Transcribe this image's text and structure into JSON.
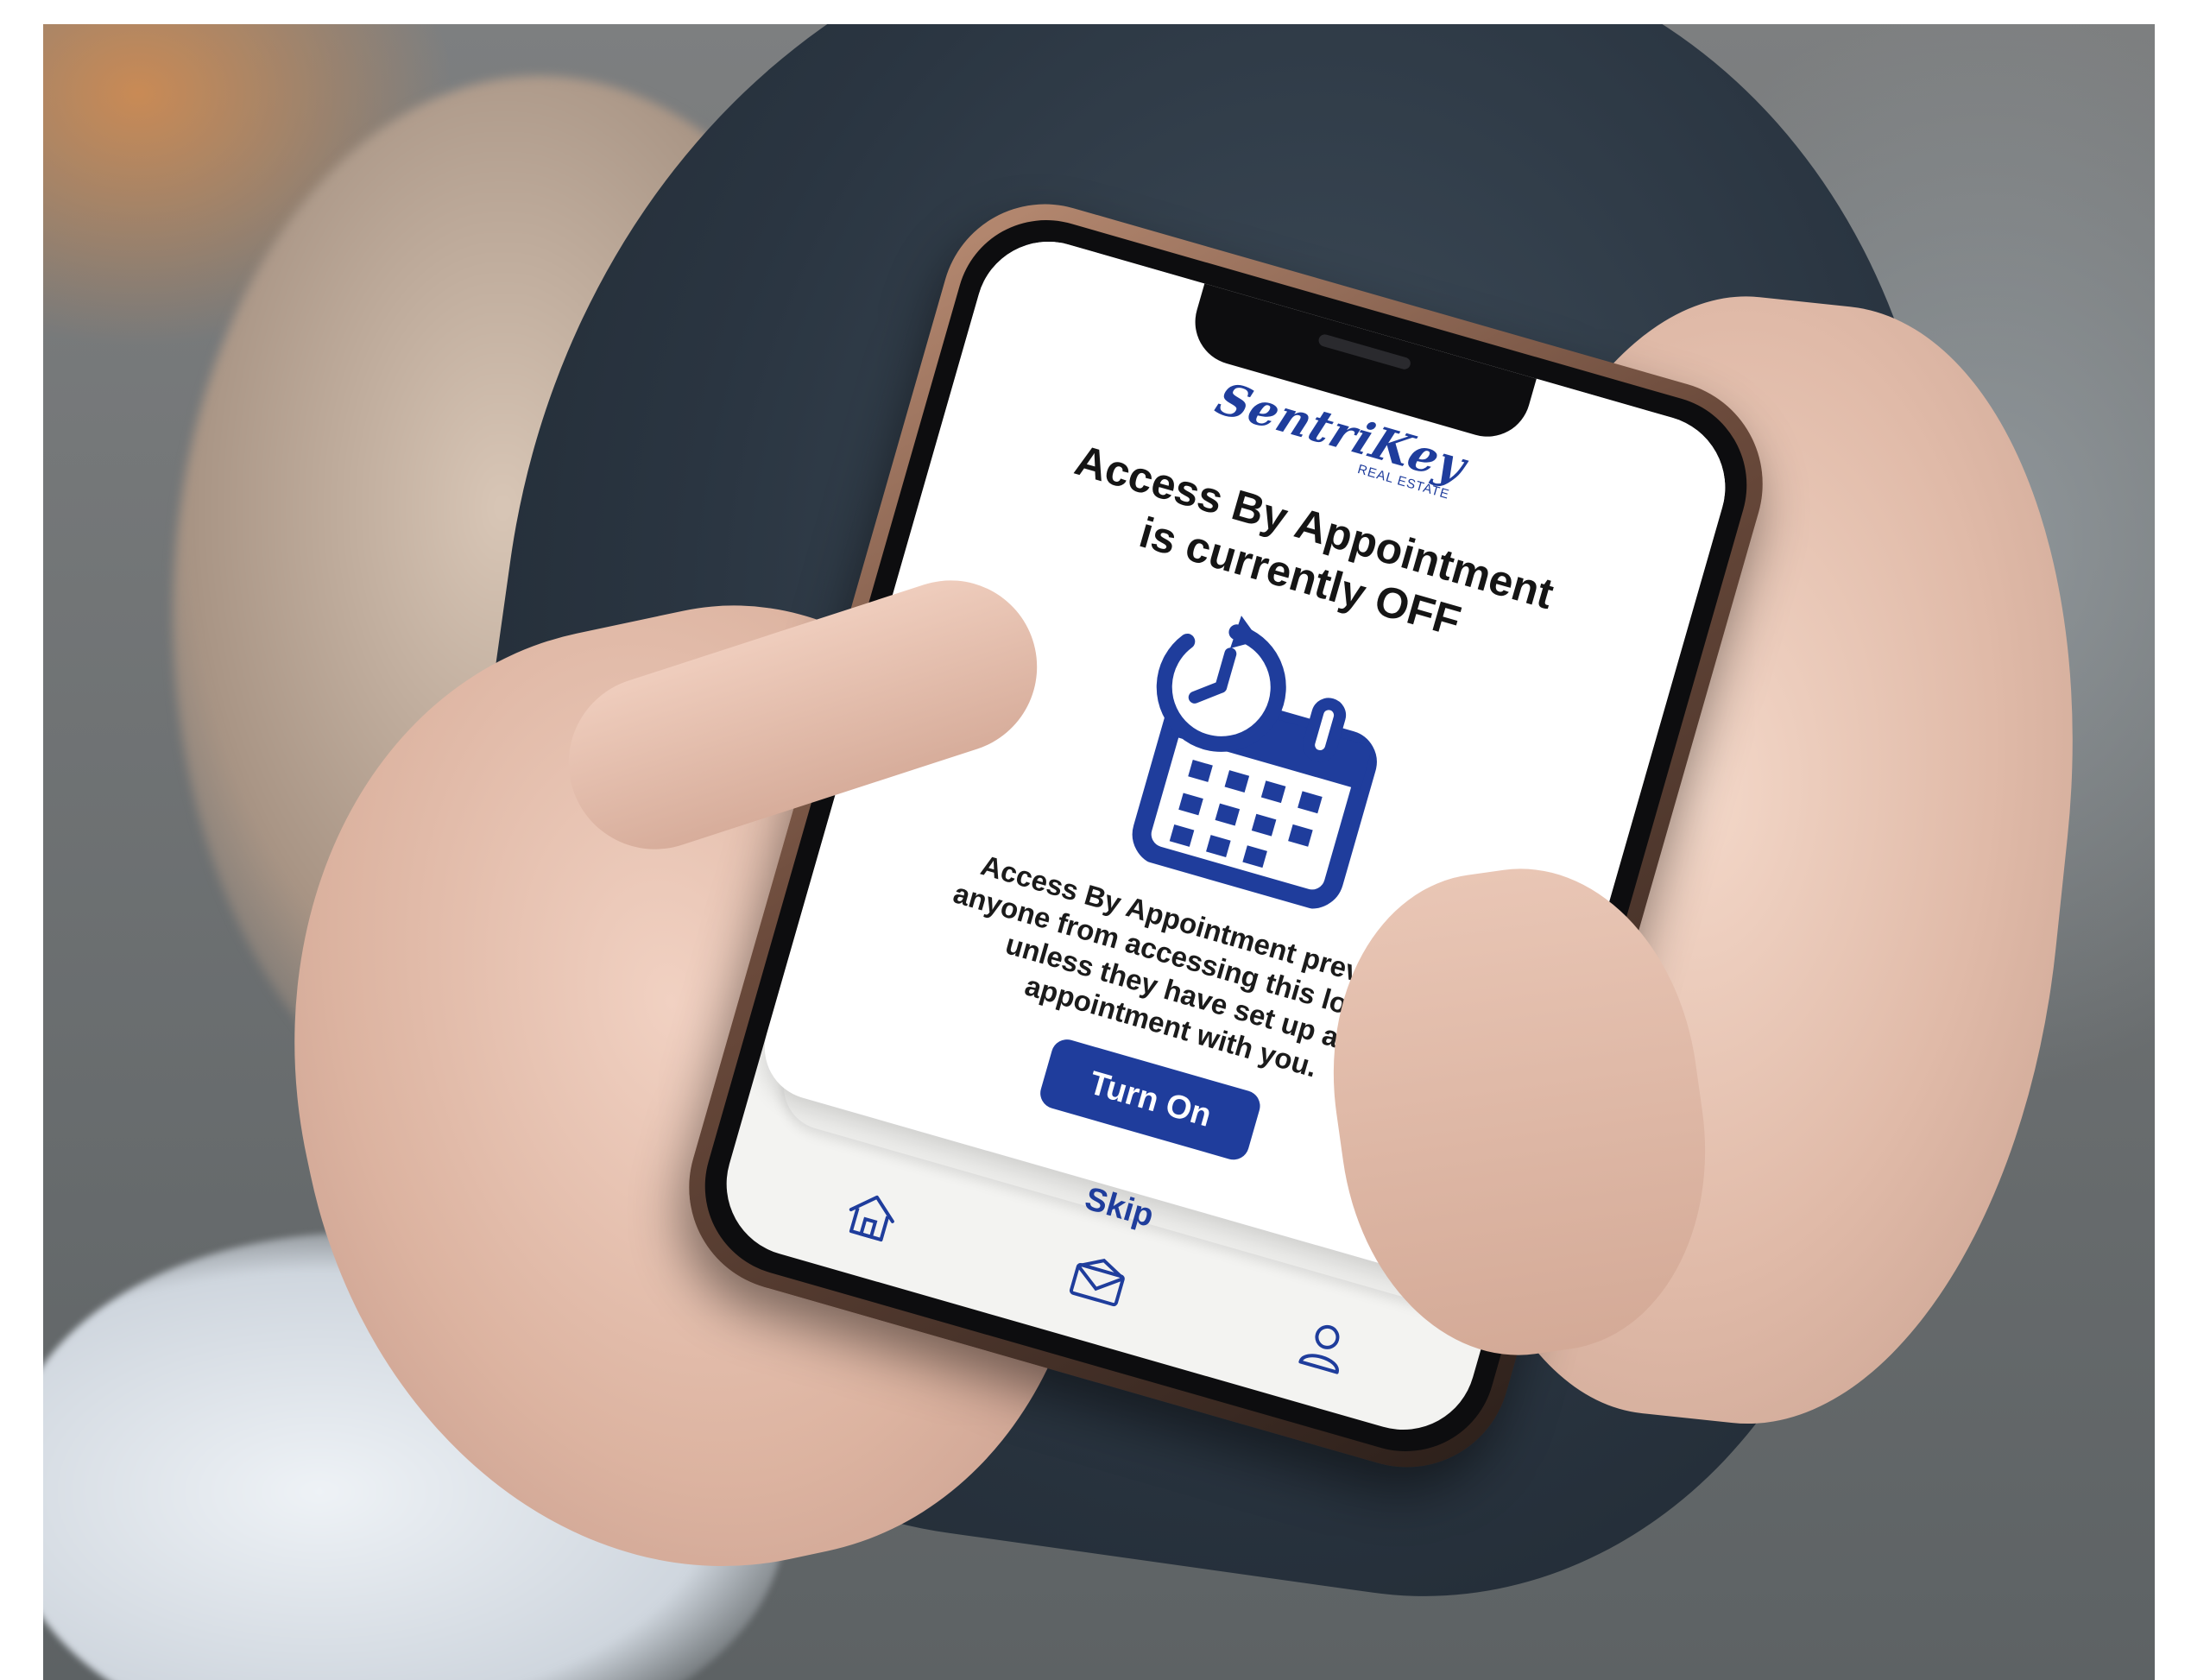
{
  "app": {
    "logo_name": "SentriKey",
    "logo_subtitle": "REAL ESTATE"
  },
  "screen": {
    "title_line1": "Access By Appointment",
    "title_line2": "is currently OFF",
    "description_lines": [
      "Access By Appointment prevents",
      "anyone from accessing this lockbox",
      "unless they have set up an",
      "appointment with you."
    ],
    "primary_button_label": "Turn On",
    "secondary_link_label": "Skip",
    "illustration_icon": "calendar-clock-icon"
  },
  "tabbar": {
    "items": [
      {
        "icon": "home-icon"
      },
      {
        "icon": "mail-icon"
      },
      {
        "icon": "profile-icon"
      }
    ]
  },
  "colors": {
    "brand_blue": "#1f3d9c",
    "screen_bg": "#ffffff",
    "text_dark": "#151515"
  }
}
